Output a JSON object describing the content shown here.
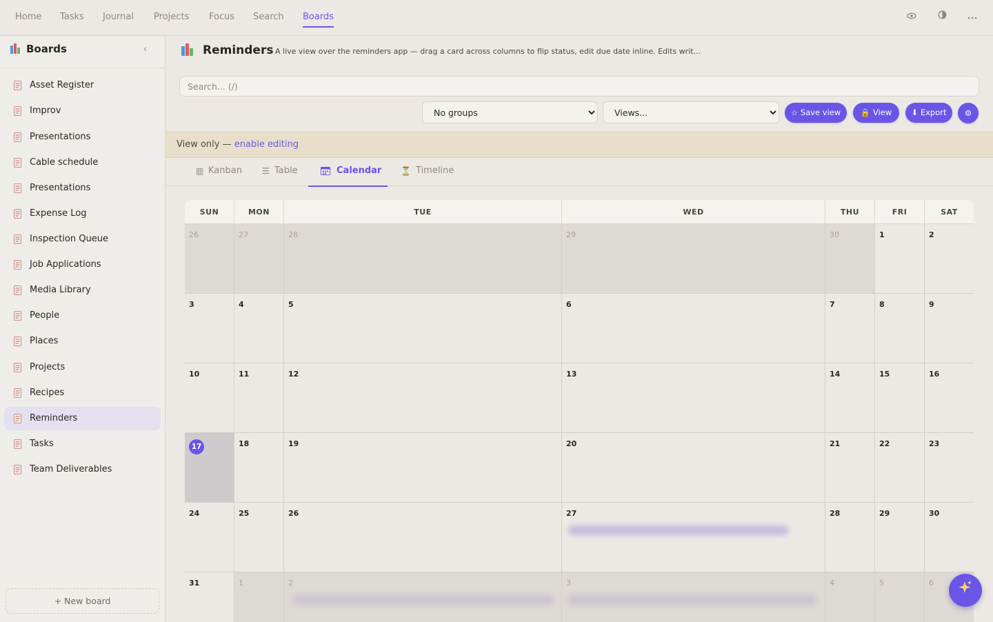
{
  "top_nav": {
    "tabs": [
      "Home",
      "Tasks",
      "Journal",
      "Projects",
      "Focus",
      "Search",
      "Boards"
    ],
    "active_tab": "Boards",
    "icons": [
      "eye-icon",
      "contrast-icon",
      "more-icon"
    ]
  },
  "sidebar": {
    "title": "Boards",
    "collapse_glyph": "‹",
    "items": [
      {
        "label": "Asset Register"
      },
      {
        "label": "Improv"
      },
      {
        "label": "Presentations"
      },
      {
        "label": "Cable schedule"
      },
      {
        "label": "Presentations"
      },
      {
        "label": "Expense Log"
      },
      {
        "label": "Inspection Queue"
      },
      {
        "label": "Job Applications"
      },
      {
        "label": "Media Library"
      },
      {
        "label": "People"
      },
      {
        "label": "Places"
      },
      {
        "label": "Projects"
      },
      {
        "label": "Recipes"
      },
      {
        "label": "Reminders"
      },
      {
        "label": "Tasks"
      },
      {
        "label": "Team Deliverables"
      }
    ],
    "active_item": "Reminders",
    "new_board_label": "+ New board"
  },
  "board": {
    "title": "Reminders",
    "description": "A live view over the reminders app — drag a card across columns to flip status, edit due date inline. Edits writ...",
    "search_placeholder": "Search... (/)",
    "group_select": "No groups",
    "views_select": "Views...",
    "buttons": {
      "save_view": "☆ Save view",
      "view": "🔒 View",
      "export": "⬇ Export",
      "settings": "⚙"
    }
  },
  "banner": {
    "text": "View only — ",
    "link": "enable editing"
  },
  "view_tabs": [
    {
      "icon": "▥",
      "label": "Kanban"
    },
    {
      "icon": "☰",
      "label": "Table"
    },
    {
      "icon": "▦",
      "label": "Calendar"
    },
    {
      "icon": "⏳",
      "label": "Timeline"
    }
  ],
  "active_view": "Calendar",
  "calendar": {
    "weekdays": [
      "SUN",
      "MON",
      "TUE",
      "WED",
      "THU",
      "FRI",
      "SAT"
    ],
    "weeks": [
      [
        {
          "d": "26",
          "out": true
        },
        {
          "d": "27",
          "out": true
        },
        {
          "d": "28",
          "out": true
        },
        {
          "d": "29",
          "out": true
        },
        {
          "d": "30",
          "out": true
        },
        {
          "d": "1"
        },
        {
          "d": "2"
        }
      ],
      [
        {
          "d": "3"
        },
        {
          "d": "4"
        },
        {
          "d": "5"
        },
        {
          "d": "6"
        },
        {
          "d": "7"
        },
        {
          "d": "8"
        },
        {
          "d": "9"
        }
      ],
      [
        {
          "d": "10"
        },
        {
          "d": "11"
        },
        {
          "d": "12"
        },
        {
          "d": "13"
        },
        {
          "d": "14"
        },
        {
          "d": "15"
        },
        {
          "d": "16"
        }
      ],
      [
        {
          "d": "17",
          "today": true
        },
        {
          "d": "18"
        },
        {
          "d": "19"
        },
        {
          "d": "20"
        },
        {
          "d": "21"
        },
        {
          "d": "22"
        },
        {
          "d": "23"
        }
      ],
      [
        {
          "d": "24"
        },
        {
          "d": "25"
        },
        {
          "d": "26"
        },
        {
          "d": "27"
        },
        {
          "d": "28"
        },
        {
          "d": "29"
        },
        {
          "d": "30"
        }
      ],
      [
        {
          "d": "31"
        },
        {
          "d": "1",
          "out": true
        },
        {
          "d": "2",
          "out": true
        },
        {
          "d": "3",
          "out": true
        },
        {
          "d": "4",
          "out": true
        },
        {
          "d": "5",
          "out": true
        },
        {
          "d": "6",
          "out": true
        }
      ]
    ]
  },
  "colors": {
    "accent": "#6A55E6",
    "banner_bg": "#E8DFCB",
    "background": "#ECE9E4"
  },
  "fab_icon": "sparkle-icon"
}
